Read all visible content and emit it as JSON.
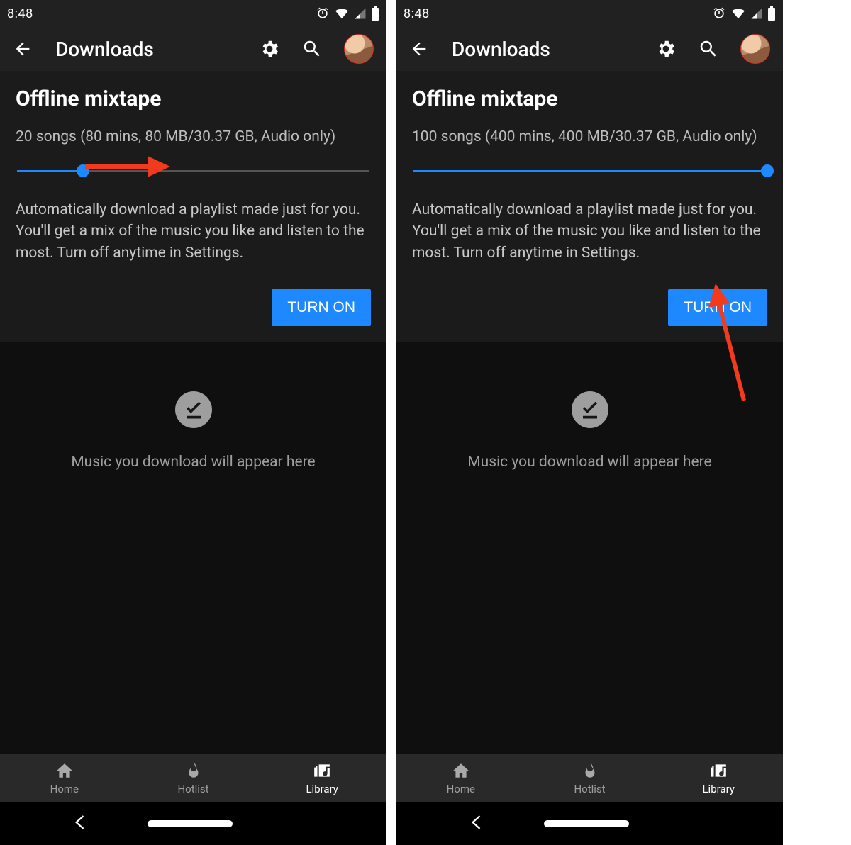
{
  "status": {
    "time": "8:48"
  },
  "appbar": {
    "title": "Downloads"
  },
  "screens": [
    {
      "section_title": "Offline mixtape",
      "summary": "20 songs (80 mins, 80 MB/30.37 GB, Audio only)",
      "slider_pct": 19,
      "description": "Automatically download a playlist made just for you. You'll get a mix of the music you like and listen to the most. Turn off anytime in Settings.",
      "button_label": "TURN ON"
    },
    {
      "section_title": "Offline mixtape",
      "summary": "100 songs (400 mins, 400 MB/30.37 GB, Audio only)",
      "slider_pct": 100,
      "description": "Automatically download a playlist made just for you. You'll get a mix of the music you like and listen to the most. Turn off anytime in Settings.",
      "button_label": "TURN ON"
    }
  ],
  "empty_state": {
    "message": "Music you download will appear here"
  },
  "tabs": [
    {
      "label": "Home",
      "active": false
    },
    {
      "label": "Hotlist",
      "active": false
    },
    {
      "label": "Library",
      "active": true
    }
  ]
}
